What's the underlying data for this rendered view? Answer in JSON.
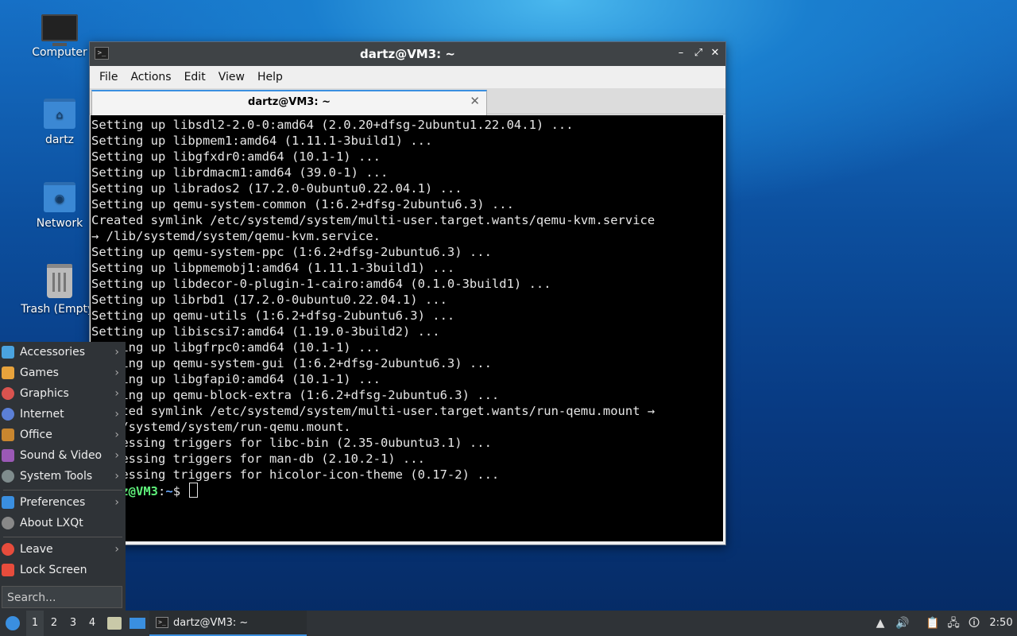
{
  "desktop": {
    "icons": [
      {
        "label": "Computer"
      },
      {
        "label": "dartz"
      },
      {
        "label": "Network"
      },
      {
        "label": "Trash (Empty)"
      }
    ]
  },
  "window": {
    "title": "dartz@VM3: ~",
    "menu": [
      "File",
      "Actions",
      "Edit",
      "View",
      "Help"
    ],
    "tab_label": "dartz@VM3: ~",
    "terminal_lines": [
      "Setting up libsdl2-2.0-0:amd64 (2.0.20+dfsg-2ubuntu1.22.04.1) ...",
      "Setting up libpmem1:amd64 (1.11.1-3build1) ...",
      "Setting up libgfxdr0:amd64 (10.1-1) ...",
      "Setting up librdmacm1:amd64 (39.0-1) ...",
      "Setting up librados2 (17.2.0-0ubuntu0.22.04.1) ...",
      "Setting up qemu-system-common (1:6.2+dfsg-2ubuntu6.3) ...",
      "Created symlink /etc/systemd/system/multi-user.target.wants/qemu-kvm.service",
      "→ /lib/systemd/system/qemu-kvm.service.",
      "Setting up qemu-system-ppc (1:6.2+dfsg-2ubuntu6.3) ...",
      "Setting up libpmemobj1:amd64 (1.11.1-3build1) ...",
      "Setting up libdecor-0-plugin-1-cairo:amd64 (0.1.0-3build1) ...",
      "Setting up librbd1 (17.2.0-0ubuntu0.22.04.1) ...",
      "Setting up qemu-utils (1:6.2+dfsg-2ubuntu6.3) ...",
      "Setting up libiscsi7:amd64 (1.19.0-3build2) ...",
      "Setting up libgfrpc0:amd64 (10.1-1) ...",
      "Setting up qemu-system-gui (1:6.2+dfsg-2ubuntu6.3) ...",
      "Setting up libgfapi0:amd64 (10.1-1) ...",
      "Setting up qemu-block-extra (1:6.2+dfsg-2ubuntu6.3) ...",
      "Created symlink /etc/systemd/system/multi-user.target.wants/run-qemu.mount →",
      "/lib/systemd/system/run-qemu.mount.",
      "Processing triggers for libc-bin (2.35-0ubuntu3.1) ...",
      "Processing triggers for man-db (2.10.2-1) ...",
      "Processing triggers for hicolor-icon-theme (0.17-2) ..."
    ],
    "prompt_user": "dartz@VM3",
    "prompt_sep": ":",
    "prompt_path": "~",
    "prompt_symbol": "$ "
  },
  "start_menu": {
    "items": [
      {
        "label": "Accessories",
        "icon": "accessories-icon",
        "color": "#4aa3df"
      },
      {
        "label": "Games",
        "icon": "games-icon",
        "color": "#e8a33c"
      },
      {
        "label": "Graphics",
        "icon": "graphics-icon",
        "color": "#d9534f"
      },
      {
        "label": "Internet",
        "icon": "internet-icon",
        "color": "#5b7fd6"
      },
      {
        "label": "Office",
        "icon": "office-icon",
        "color": "#c8862f"
      },
      {
        "label": "Sound & Video",
        "icon": "sound-video-icon",
        "color": "#9b59b6"
      },
      {
        "label": "System Tools",
        "icon": "system-tools-icon",
        "color": "#7f8c8d"
      },
      {
        "label": "Preferences",
        "icon": "preferences-icon",
        "color": "#3a8fe0"
      },
      {
        "label": "About LXQt",
        "icon": "about-icon",
        "color": "#888888"
      },
      {
        "label": "Leave",
        "icon": "leave-icon",
        "color": "#e74c3c"
      },
      {
        "label": "Lock Screen",
        "icon": "lock-icon",
        "color": "#e74c3c"
      }
    ],
    "search_placeholder": "Search..."
  },
  "taskbar": {
    "desktops": [
      "1",
      "2",
      "3",
      "4"
    ],
    "active_desktop": "1",
    "task_label": "dartz@VM3: ~",
    "clock": "2:50"
  }
}
